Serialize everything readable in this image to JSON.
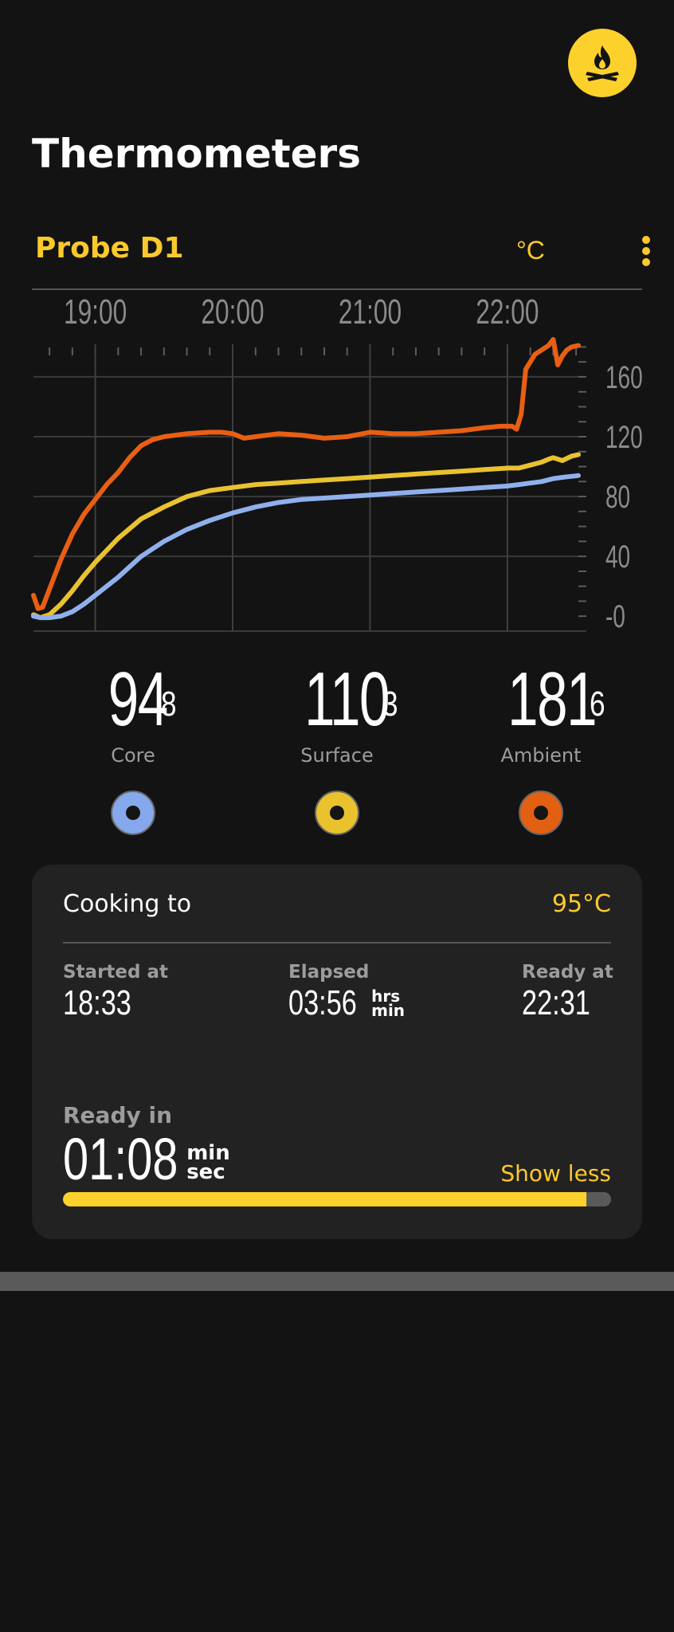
{
  "header": {
    "title": "Thermometers",
    "fire_icon": "campfire-icon"
  },
  "probe": {
    "name": "Probe D1",
    "unit": "°C",
    "menu_icon": "more-vertical-icon"
  },
  "chart_data": {
    "type": "line",
    "x_ticks": [
      "19:00",
      "20:00",
      "21:00",
      "22:00"
    ],
    "y_ticks": [
      "-0",
      "40",
      "80",
      "120",
      "160"
    ],
    "xlim": [
      "18:33",
      "22:31"
    ],
    "ylim": [
      -10,
      185
    ],
    "grid": true,
    "series": [
      {
        "key": "ambient",
        "color": "#e85f13",
        "x": [
          "18:33",
          "18:35",
          "18:37",
          "18:40",
          "18:45",
          "18:50",
          "18:55",
          "19:00",
          "19:05",
          "19:10",
          "19:15",
          "19:20",
          "19:25",
          "19:30",
          "19:40",
          "19:50",
          "19:55",
          "20:00",
          "20:05",
          "20:10",
          "20:20",
          "20:30",
          "20:40",
          "20:50",
          "21:00",
          "21:10",
          "21:20",
          "21:30",
          "21:40",
          "21:50",
          "21:57",
          "22:00",
          "22:02",
          "22:04",
          "22:06",
          "22:08",
          "22:12",
          "22:15",
          "22:18",
          "22:20",
          "22:22",
          "22:24",
          "22:26",
          "22:28",
          "22:31"
        ],
        "y": [
          14,
          5,
          6,
          18,
          38,
          55,
          68,
          78,
          88,
          96,
          106,
          114,
          118,
          120,
          122,
          123,
          123,
          122,
          119,
          120,
          122,
          121,
          119,
          120,
          123,
          122,
          122,
          123,
          124,
          126,
          127,
          127,
          127,
          125,
          135,
          165,
          175,
          178,
          181,
          185,
          168,
          174,
          178,
          180,
          181
        ]
      },
      {
        "key": "surface",
        "color": "#e9c230",
        "x": [
          "18:33",
          "18:36",
          "18:40",
          "18:45",
          "18:50",
          "18:55",
          "19:00",
          "19:10",
          "19:20",
          "19:30",
          "19:40",
          "19:50",
          "20:00",
          "20:10",
          "20:20",
          "20:30",
          "20:40",
          "20:50",
          "21:00",
          "21:10",
          "21:20",
          "21:30",
          "21:40",
          "21:50",
          "22:00",
          "22:05",
          "22:10",
          "22:15",
          "22:18",
          "22:20",
          "22:24",
          "22:28",
          "22:31"
        ],
        "y": [
          1,
          -1,
          1,
          8,
          17,
          27,
          36,
          52,
          65,
          73,
          80,
          84,
          86,
          88,
          89,
          90,
          91,
          92,
          93,
          94,
          95,
          96,
          97,
          98,
          99,
          99,
          101,
          103,
          105,
          106,
          104,
          107,
          108
        ]
      },
      {
        "key": "core",
        "color": "#8fb0ec",
        "x": [
          "18:33",
          "18:36",
          "18:40",
          "18:45",
          "18:50",
          "18:55",
          "19:00",
          "19:10",
          "19:20",
          "19:30",
          "19:40",
          "19:50",
          "20:00",
          "20:10",
          "20:20",
          "20:30",
          "20:40",
          "20:50",
          "21:00",
          "21:10",
          "21:20",
          "21:30",
          "21:40",
          "21:50",
          "22:00",
          "22:05",
          "22:10",
          "22:15",
          "22:20",
          "22:25",
          "22:31"
        ],
        "y": [
          0,
          -1,
          -1,
          0,
          3,
          8,
          14,
          26,
          40,
          50,
          58,
          64,
          69,
          73,
          76,
          78,
          79,
          80,
          81,
          82,
          83,
          84,
          85,
          86,
          87,
          88,
          89,
          90,
          92,
          93,
          94
        ]
      }
    ]
  },
  "readings": [
    {
      "key": "core",
      "main": "94",
      "dec": "8",
      "label": "Core",
      "color": "#86a8ec"
    },
    {
      "key": "surface",
      "main": "110",
      "dec": "3",
      "label": "Surface",
      "color": "#e9c22e"
    },
    {
      "key": "ambient",
      "main": "181",
      "dec": "6",
      "label": "Ambient",
      "color": "#e35f12"
    }
  ],
  "cook": {
    "label": "Cooking to",
    "target": "95°C",
    "started_label": "Started at",
    "started_value": "18:33",
    "elapsed_label": "Elapsed",
    "elapsed_value": "03:56",
    "elapsed_unit_1": "hrs",
    "elapsed_unit_2": "min",
    "ready_at_label": "Ready at",
    "ready_at_value": "22:31",
    "ready_in_label": "Ready in",
    "ready_in_value": "01:08",
    "ready_in_unit_1": "min",
    "ready_in_unit_2": "sec",
    "toggle_label": "Show less",
    "progress": 0.955
  },
  "colors": {
    "accent": "#fcc92d",
    "background": "#131313",
    "card": "#222222"
  }
}
